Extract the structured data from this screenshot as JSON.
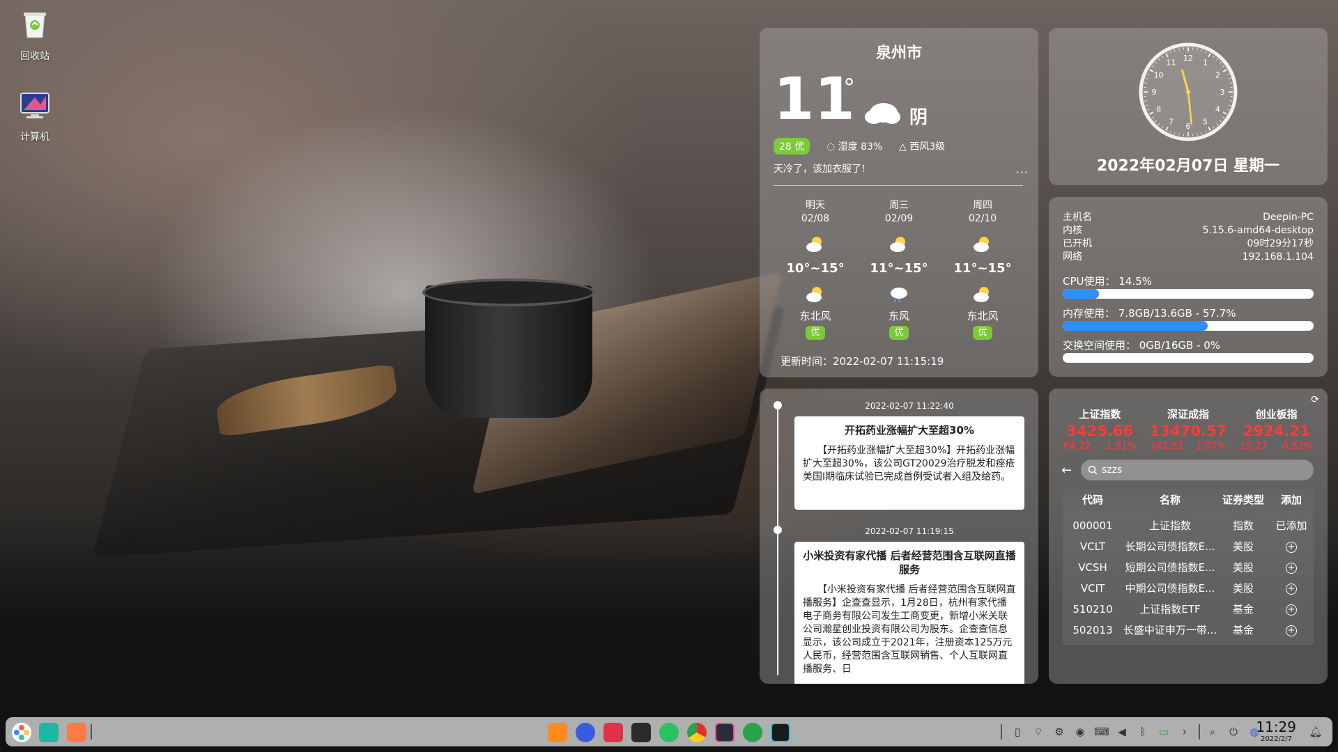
{
  "desktop": {
    "icons": [
      {
        "label": "回收站",
        "icon": "trash-icon"
      },
      {
        "label": "计算机",
        "icon": "computer-icon"
      }
    ]
  },
  "weather": {
    "city": "泉州市",
    "temp": "11",
    "deg": "°",
    "condition": "阴",
    "aqi": "28 优",
    "humidity": "湿度 83%",
    "wind": "西风3级",
    "tip": "天冷了，该加衣服了!",
    "more": "···",
    "forecast": [
      {
        "name": "明天",
        "date": "02/08",
        "range": "10°~15°",
        "wind": "东北风",
        "aqi": "优"
      },
      {
        "name": "周三",
        "date": "02/09",
        "range": "11°~15°",
        "wind": "东风",
        "aqi": "优"
      },
      {
        "name": "周四",
        "date": "02/10",
        "range": "11°~15°",
        "wind": "东北风",
        "aqi": "优"
      }
    ],
    "update": "更新时间：2022-02-07 11:15:19"
  },
  "clock": {
    "date": "2022年02月07日 星期一",
    "hour": 11,
    "minute": 29,
    "numbers": [
      "12",
      "1",
      "2",
      "3",
      "4",
      "5",
      "6",
      "7",
      "8",
      "9",
      "10",
      "11"
    ]
  },
  "sysinfo": {
    "hostname_label": "主机名",
    "hostname": "Deepin-PC",
    "kernel_label": "内核",
    "kernel": "5.15.6-amd64-desktop",
    "uptime_label": "已开机",
    "uptime": "09时29分17秒",
    "network_label": "网络",
    "network": "192.168.1.104",
    "cpu": "CPU使用：  14.5%",
    "cpu_pct": 14.5,
    "mem": "内存使用：  7.8GB/13.6GB - 57.7%",
    "mem_pct": 57.7,
    "swap": "交换空间使用：  0GB/16GB - 0%",
    "swap_pct": 0
  },
  "news": [
    {
      "time": "2022-02-07 11:22:40",
      "title": "开拓药业涨幅扩大至超30%",
      "body": "【开拓药业涨幅扩大至超30%】开拓药业涨幅扩大至超30%，该公司GT20029治疗脱发和痤疮美国I期临床试验已完成首例受试者入组及给药。"
    },
    {
      "time": "2022-02-07 11:19:15",
      "title": "小米投资有家代播 后者经营范围含互联网直播服务",
      "body": "【小米投资有家代播 后者经营范围含互联网直播服务】企查查显示，1月28日，杭州有家代播电子商务有限公司发生工商变更，新增小米关联公司瀚星创业投资有限公司为股东。企查查信息显示，该公司成立于2021年，注册资本125万元人民币，经营范围含互联网销售、个人互联网直播服务、日"
    }
  ],
  "stocks": {
    "indices": [
      {
        "name": "上证指数",
        "value": "3425.66",
        "chg": "64.22",
        "pct": "1.91%"
      },
      {
        "name": "深证成指",
        "value": "13470.57",
        "chg": "142.51",
        "pct": "1.07%"
      },
      {
        "name": "创业板指",
        "value": "2924.21",
        "chg": "15.27",
        "pct": "0.52%"
      }
    ],
    "search_value": "szzs",
    "headers": [
      "代码",
      "名称",
      "证券类型",
      "添加"
    ],
    "rows": [
      {
        "code": "000001",
        "name": "上证指数",
        "type": "指数",
        "add": "已添加"
      },
      {
        "code": "VCLT",
        "name": "长期公司债指数E...",
        "type": "美股",
        "add": "+"
      },
      {
        "code": "VCSH",
        "name": "短期公司债指数E...",
        "type": "美股",
        "add": "+"
      },
      {
        "code": "VCIT",
        "name": "中期公司债指数E...",
        "type": "美股",
        "add": "+"
      },
      {
        "code": "510210",
        "name": "上证指数ETF",
        "type": "基金",
        "add": "+"
      },
      {
        "code": "502013",
        "name": "长盛中证申万一带...",
        "type": "基金",
        "add": "+"
      }
    ]
  },
  "taskbar": {
    "time": "11:29",
    "date": "2022/2/7"
  },
  "colors": {
    "accent_blue": "#2f8fff",
    "stock_red": "#ff3a3a",
    "aqi_green": "#7cc93a"
  }
}
